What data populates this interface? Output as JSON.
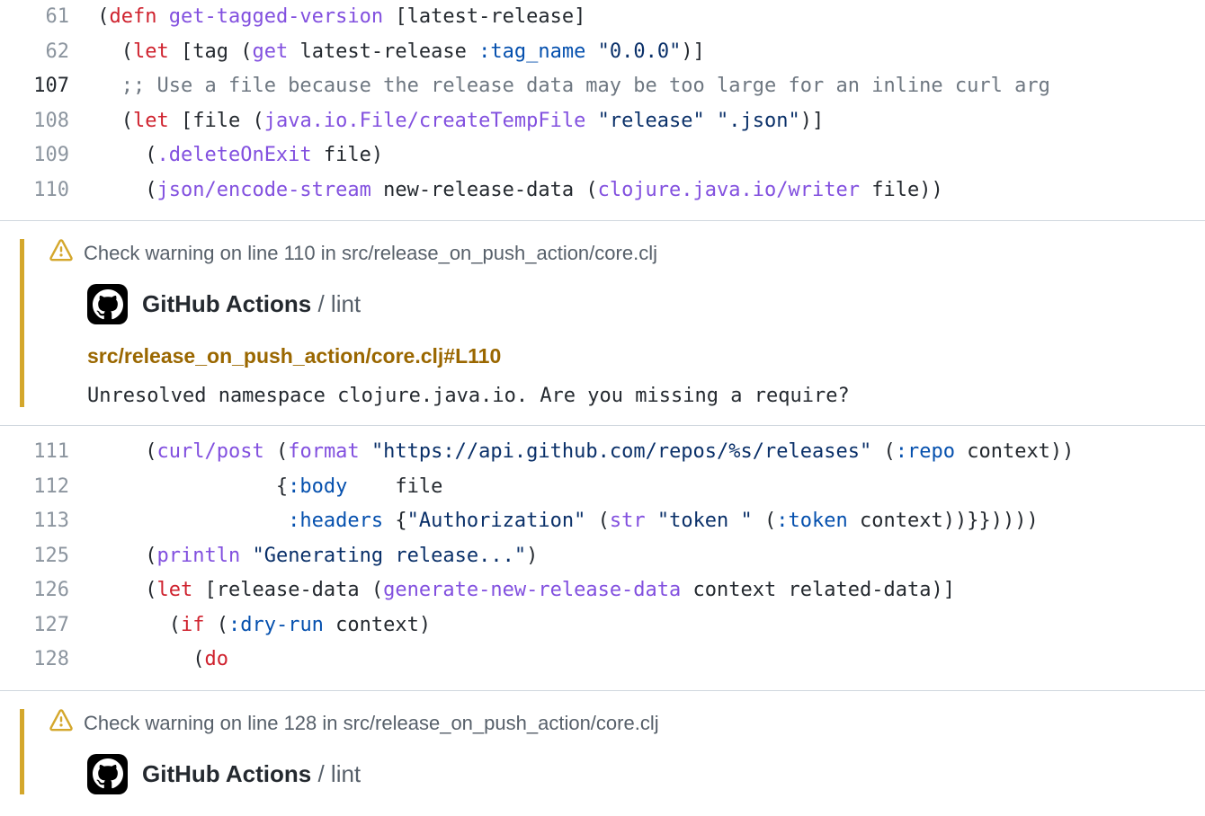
{
  "code": {
    "lines1": [
      {
        "num": "61",
        "dark": false,
        "tokens": [
          {
            "t": " (",
            "c": "c-black"
          },
          {
            "t": "defn",
            "c": "c-red"
          },
          {
            "t": " ",
            "c": "c-black"
          },
          {
            "t": "get-tagged-version",
            "c": "c-purple"
          },
          {
            "t": " [latest-release]",
            "c": "c-black"
          }
        ]
      },
      {
        "num": "62",
        "dark": false,
        "tokens": [
          {
            "t": "   (",
            "c": "c-black"
          },
          {
            "t": "let",
            "c": "c-red"
          },
          {
            "t": " [tag (",
            "c": "c-black"
          },
          {
            "t": "get",
            "c": "c-purple"
          },
          {
            "t": " latest-release ",
            "c": "c-black"
          },
          {
            "t": ":tag_name",
            "c": "c-blue"
          },
          {
            "t": " ",
            "c": "c-black"
          },
          {
            "t": "\"0.0.0\"",
            "c": "c-str"
          },
          {
            "t": ")]",
            "c": "c-black"
          }
        ]
      },
      {
        "num": "107",
        "dark": true,
        "tokens": [
          {
            "t": "   ",
            "c": "c-black"
          },
          {
            "t": ";; Use a file because the release data may be too large for an inline curl arg",
            "c": "c-gray"
          }
        ]
      },
      {
        "num": "108",
        "dark": false,
        "tokens": [
          {
            "t": "   (",
            "c": "c-black"
          },
          {
            "t": "let",
            "c": "c-red"
          },
          {
            "t": " [file (",
            "c": "c-black"
          },
          {
            "t": "java.io.File/createTempFile",
            "c": "c-purple"
          },
          {
            "t": " ",
            "c": "c-black"
          },
          {
            "t": "\"release\"",
            "c": "c-str"
          },
          {
            "t": " ",
            "c": "c-black"
          },
          {
            "t": "\".json\"",
            "c": "c-str"
          },
          {
            "t": ")]",
            "c": "c-black"
          }
        ]
      },
      {
        "num": "109",
        "dark": false,
        "tokens": [
          {
            "t": "     (",
            "c": "c-black"
          },
          {
            "t": ".deleteOnExit",
            "c": "c-purple"
          },
          {
            "t": " file)",
            "c": "c-black"
          }
        ]
      },
      {
        "num": "110",
        "dark": false,
        "tokens": [
          {
            "t": "     (",
            "c": "c-black"
          },
          {
            "t": "json/encode-stream",
            "c": "c-purple"
          },
          {
            "t": " new-release-data (",
            "c": "c-black"
          },
          {
            "t": "clojure.java.io/writer",
            "c": "c-purple"
          },
          {
            "t": " file))",
            "c": "c-black"
          }
        ]
      }
    ],
    "lines2": [
      {
        "num": "111",
        "dark": false,
        "tokens": [
          {
            "t": "     (",
            "c": "c-black"
          },
          {
            "t": "curl/post",
            "c": "c-purple"
          },
          {
            "t": " (",
            "c": "c-black"
          },
          {
            "t": "format",
            "c": "c-purple"
          },
          {
            "t": " ",
            "c": "c-black"
          },
          {
            "t": "\"https://api.github.com/repos/%s/releases\"",
            "c": "c-str"
          },
          {
            "t": " (",
            "c": "c-black"
          },
          {
            "t": ":repo",
            "c": "c-blue"
          },
          {
            "t": " context))",
            "c": "c-black"
          }
        ]
      },
      {
        "num": "112",
        "dark": false,
        "tokens": [
          {
            "t": "                {",
            "c": "c-black"
          },
          {
            "t": ":body",
            "c": "c-blue"
          },
          {
            "t": "    file",
            "c": "c-black"
          }
        ]
      },
      {
        "num": "113",
        "dark": false,
        "tokens": [
          {
            "t": "                 ",
            "c": "c-black"
          },
          {
            "t": ":headers",
            "c": "c-blue"
          },
          {
            "t": " {",
            "c": "c-black"
          },
          {
            "t": "\"Authorization\"",
            "c": "c-str"
          },
          {
            "t": " (",
            "c": "c-black"
          },
          {
            "t": "str",
            "c": "c-purple"
          },
          {
            "t": " ",
            "c": "c-black"
          },
          {
            "t": "\"token \"",
            "c": "c-str"
          },
          {
            "t": " (",
            "c": "c-black"
          },
          {
            "t": ":token",
            "c": "c-blue"
          },
          {
            "t": " context))}}))))",
            "c": "c-black"
          }
        ]
      },
      {
        "num": "125",
        "dark": false,
        "tokens": [
          {
            "t": "     (",
            "c": "c-black"
          },
          {
            "t": "println",
            "c": "c-purple"
          },
          {
            "t": " ",
            "c": "c-black"
          },
          {
            "t": "\"Generating release...\"",
            "c": "c-str"
          },
          {
            "t": ")",
            "c": "c-black"
          }
        ]
      },
      {
        "num": "126",
        "dark": false,
        "tokens": [
          {
            "t": "     (",
            "c": "c-black"
          },
          {
            "t": "let",
            "c": "c-red"
          },
          {
            "t": " [release-data (",
            "c": "c-black"
          },
          {
            "t": "generate-new-release-data",
            "c": "c-purple"
          },
          {
            "t": " context related-data)]",
            "c": "c-black"
          }
        ]
      },
      {
        "num": "127",
        "dark": false,
        "tokens": [
          {
            "t": "       (",
            "c": "c-black"
          },
          {
            "t": "if",
            "c": "c-red"
          },
          {
            "t": " (",
            "c": "c-black"
          },
          {
            "t": ":dry-run",
            "c": "c-blue"
          },
          {
            "t": " context)",
            "c": "c-black"
          }
        ]
      },
      {
        "num": "128",
        "dark": false,
        "tokens": [
          {
            "t": "         (",
            "c": "c-black"
          },
          {
            "t": "do",
            "c": "c-red"
          }
        ]
      }
    ]
  },
  "annotation1": {
    "header": "Check warning on line 110 in src/release_on_push_action/core.clj",
    "actions_bold": "GitHub Actions",
    "actions_sep": " / ",
    "actions_thin": "lint",
    "file_link": "src/release_on_push_action/core.clj#L110",
    "message": "Unresolved namespace clojure.java.io. Are you missing a require?"
  },
  "annotation2": {
    "header": "Check warning on line 128 in src/release_on_push_action/core.clj",
    "actions_bold": "GitHub Actions",
    "actions_sep": " / ",
    "actions_thin": "lint"
  }
}
